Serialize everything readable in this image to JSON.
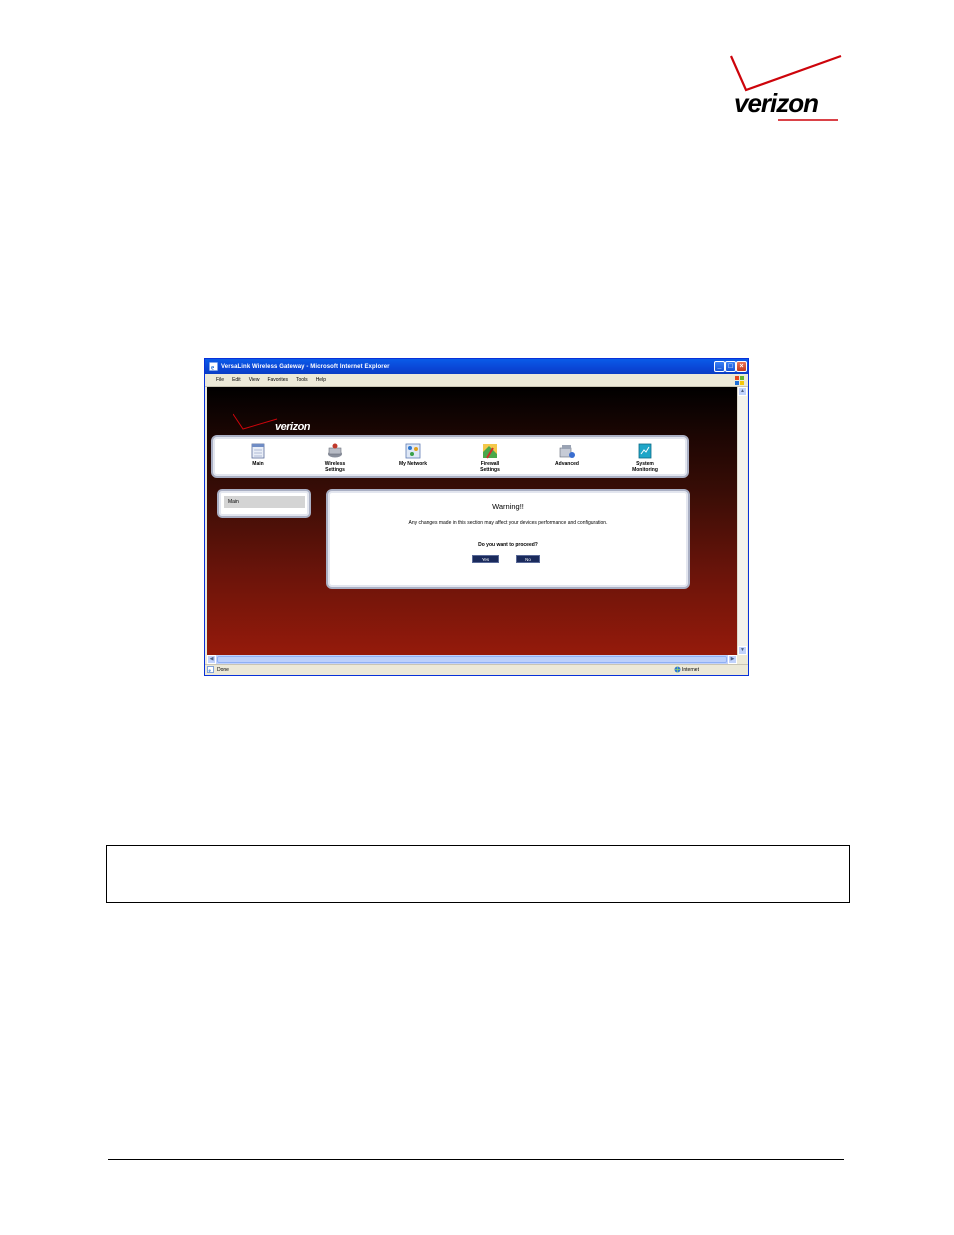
{
  "document": {
    "logo_text": "verizon"
  },
  "window": {
    "title": "VersaLink Wireless Gateway - Microsoft Internet Explorer",
    "menu": [
      "File",
      "Edit",
      "View",
      "Favorites",
      "Tools",
      "Help"
    ],
    "status_text": "Done",
    "status_zone": "Internet"
  },
  "page": {
    "logo_text": "verizon",
    "nav": [
      {
        "label": "Main",
        "icon": "main-calendar-icon"
      },
      {
        "label": "Wireless\nSettings",
        "icon": "wireless-router-icon"
      },
      {
        "label": "My Network",
        "icon": "my-network-icon"
      },
      {
        "label": "Firewall\nSettings",
        "icon": "firewall-icon"
      },
      {
        "label": "Advanced",
        "icon": "advanced-icon"
      },
      {
        "label": "System\nMonitoring",
        "icon": "system-monitoring-icon"
      }
    ],
    "side_menu": {
      "main_label": "Main"
    },
    "warning": {
      "title": "Warning!!",
      "message": "Any changes made in this section may affect your devices performance and configuration.",
      "question": "Do you want to proceed?",
      "yes_label": "Yes",
      "no_label": "No"
    }
  },
  "colors": {
    "verizon_red": "#cd040b",
    "title_bar": "#0a46d6",
    "button_navy": "#1a2a5c"
  }
}
